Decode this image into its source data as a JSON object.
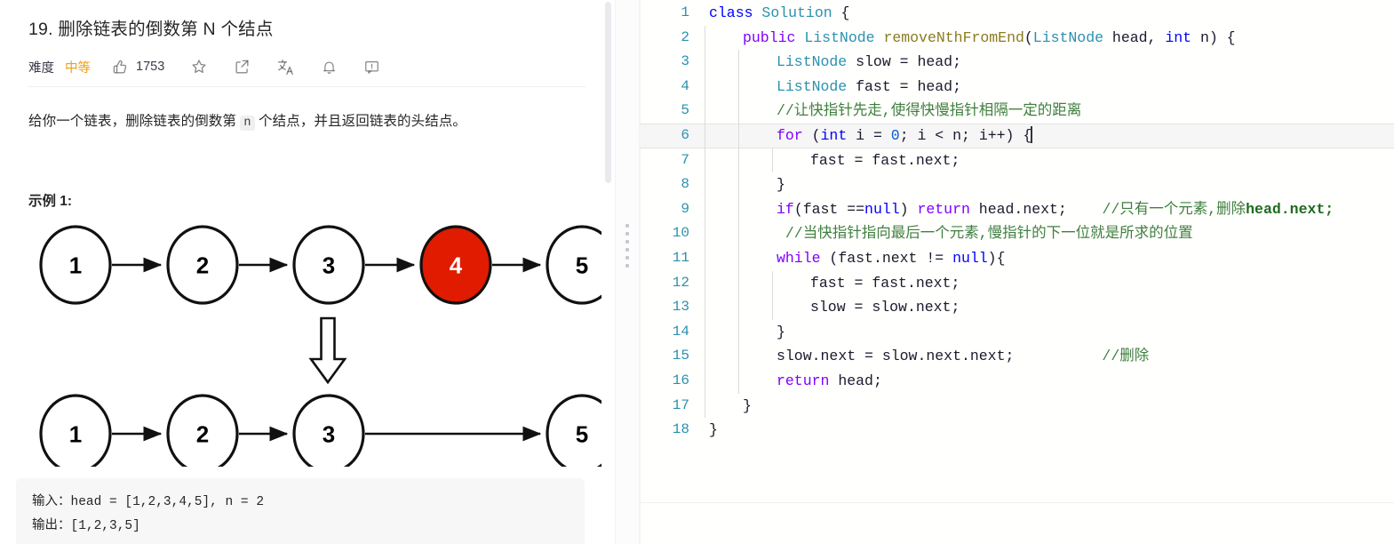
{
  "problem": {
    "title": "19. 删除链表的倒数第 N 个结点",
    "meta": {
      "difficulty_label": "难度",
      "difficulty_value": "中等",
      "difficulty_color": "#ef9f18",
      "like_count": "1753",
      "icons": [
        "thumbs-up-icon",
        "star-icon",
        "share-icon",
        "translate-icon",
        "bell-icon",
        "feedback-icon"
      ]
    },
    "description_pre": "给你一个链表，删除链表的倒数第 ",
    "description_code": "n",
    "description_post": " 个结点，并且返回链表的头结点。",
    "example_heading": "示例 1:",
    "example_io": "输入：head = [1,2,3,4,5], n = 2\n输出：[1,2,3,5]"
  },
  "diagram": {
    "row1": {
      "nodes": [
        "1",
        "2",
        "3",
        "4",
        "5"
      ],
      "highlighted_index": 3,
      "highlight_color": "#e01b00",
      "node_text_color": "#000000",
      "highlight_text_color": "#ffffff"
    },
    "row2": {
      "nodes": [
        "1",
        "2",
        "3",
        "5"
      ]
    },
    "down_arrow": "down-arrow-glyph"
  },
  "editor": {
    "language": "java",
    "active_line": 6,
    "lines": [
      {
        "n": "1",
        "indent": 0,
        "tokens": [
          {
            "t": "class",
            "c": "kw"
          },
          {
            "t": " ",
            "c": "plain"
          },
          {
            "t": "Solution",
            "c": "type"
          },
          {
            "t": " {",
            "c": "punct"
          }
        ]
      },
      {
        "n": "2",
        "indent": 1,
        "tokens": [
          {
            "t": "public",
            "c": "kw2"
          },
          {
            "t": " ",
            "c": "plain"
          },
          {
            "t": "ListNode",
            "c": "type"
          },
          {
            "t": " ",
            "c": "plain"
          },
          {
            "t": "removeNthFromEnd",
            "c": "fn"
          },
          {
            "t": "(",
            "c": "punct"
          },
          {
            "t": "ListNode",
            "c": "type"
          },
          {
            "t": " ",
            "c": "plain"
          },
          {
            "t": "head",
            "c": "plain"
          },
          {
            "t": ", ",
            "c": "punct"
          },
          {
            "t": "int",
            "c": "kw"
          },
          {
            "t": " ",
            "c": "plain"
          },
          {
            "t": "n",
            "c": "plain"
          },
          {
            "t": ") {",
            "c": "punct"
          }
        ]
      },
      {
        "n": "3",
        "indent": 2,
        "tokens": [
          {
            "t": "ListNode",
            "c": "type"
          },
          {
            "t": " ",
            "c": "plain"
          },
          {
            "t": "slow",
            "c": "plain"
          },
          {
            "t": " = ",
            "c": "punct"
          },
          {
            "t": "head",
            "c": "plain"
          },
          {
            "t": ";",
            "c": "punct"
          }
        ]
      },
      {
        "n": "4",
        "indent": 2,
        "tokens": [
          {
            "t": "ListNode",
            "c": "type"
          },
          {
            "t": " ",
            "c": "plain"
          },
          {
            "t": "fast",
            "c": "plain"
          },
          {
            "t": " = ",
            "c": "punct"
          },
          {
            "t": "head",
            "c": "plain"
          },
          {
            "t": ";",
            "c": "punct"
          }
        ]
      },
      {
        "n": "5",
        "indent": 2,
        "tokens": [
          {
            "t": "//让快指针先走,使得快慢指针相隔一定的距离",
            "c": "cmt"
          }
        ]
      },
      {
        "n": "6",
        "indent": 2,
        "active": true,
        "tokens": [
          {
            "t": "for",
            "c": "kw2"
          },
          {
            "t": " (",
            "c": "punct"
          },
          {
            "t": "int",
            "c": "kw"
          },
          {
            "t": " ",
            "c": "plain"
          },
          {
            "t": "i",
            "c": "plain"
          },
          {
            "t": " = ",
            "c": "punct"
          },
          {
            "t": "0",
            "c": "num"
          },
          {
            "t": "; ",
            "c": "punct"
          },
          {
            "t": "i",
            "c": "plain"
          },
          {
            "t": " < ",
            "c": "punct"
          },
          {
            "t": "n",
            "c": "plain"
          },
          {
            "t": "; ",
            "c": "punct"
          },
          {
            "t": "i",
            "c": "plain"
          },
          {
            "t": "++) {",
            "c": "punct"
          }
        ],
        "caret_after": true
      },
      {
        "n": "7",
        "indent": 3,
        "tokens": [
          {
            "t": "fast",
            "c": "plain"
          },
          {
            "t": " = ",
            "c": "punct"
          },
          {
            "t": "fast",
            "c": "plain"
          },
          {
            "t": ".",
            "c": "punct"
          },
          {
            "t": "next",
            "c": "plain"
          },
          {
            "t": ";",
            "c": "punct"
          }
        ]
      },
      {
        "n": "8",
        "indent": 2,
        "tokens": [
          {
            "t": "}",
            "c": "punct"
          }
        ]
      },
      {
        "n": "9",
        "indent": 2,
        "tokens": [
          {
            "t": "if",
            "c": "kw2"
          },
          {
            "t": "(",
            "c": "punct"
          },
          {
            "t": "fast",
            "c": "plain"
          },
          {
            "t": " ==",
            "c": "punct"
          },
          {
            "t": "null",
            "c": "kw"
          },
          {
            "t": ") ",
            "c": "punct"
          },
          {
            "t": "return",
            "c": "kw2"
          },
          {
            "t": " ",
            "c": "plain"
          },
          {
            "t": "head",
            "c": "plain"
          },
          {
            "t": ".",
            "c": "punct"
          },
          {
            "t": "next",
            "c": "plain"
          },
          {
            "t": ";",
            "c": "punct"
          },
          {
            "t": "    ",
            "c": "plain"
          },
          {
            "t": "//只有一个元素,删除",
            "c": "cmt"
          },
          {
            "t": "head.next;",
            "c": "cmt-b"
          }
        ]
      },
      {
        "n": "10",
        "indent": 2,
        "tokens": [
          {
            "t": " //当快指针指向最后一个元素,慢指针的下一位就是所求的位置",
            "c": "cmt"
          }
        ]
      },
      {
        "n": "11",
        "indent": 2,
        "tokens": [
          {
            "t": "while",
            "c": "kw2"
          },
          {
            "t": " (",
            "c": "punct"
          },
          {
            "t": "fast",
            "c": "plain"
          },
          {
            "t": ".",
            "c": "punct"
          },
          {
            "t": "next",
            "c": "plain"
          },
          {
            "t": " != ",
            "c": "punct"
          },
          {
            "t": "null",
            "c": "kw"
          },
          {
            "t": "){",
            "c": "punct"
          }
        ]
      },
      {
        "n": "12",
        "indent": 3,
        "tokens": [
          {
            "t": "fast",
            "c": "plain"
          },
          {
            "t": " = ",
            "c": "punct"
          },
          {
            "t": "fast",
            "c": "plain"
          },
          {
            "t": ".",
            "c": "punct"
          },
          {
            "t": "next",
            "c": "plain"
          },
          {
            "t": ";",
            "c": "punct"
          }
        ]
      },
      {
        "n": "13",
        "indent": 3,
        "tokens": [
          {
            "t": "slow",
            "c": "plain"
          },
          {
            "t": " = ",
            "c": "punct"
          },
          {
            "t": "slow",
            "c": "plain"
          },
          {
            "t": ".",
            "c": "punct"
          },
          {
            "t": "next",
            "c": "plain"
          },
          {
            "t": ";",
            "c": "punct"
          }
        ]
      },
      {
        "n": "14",
        "indent": 2,
        "tokens": [
          {
            "t": "}",
            "c": "punct"
          }
        ]
      },
      {
        "n": "15",
        "indent": 2,
        "tokens": [
          {
            "t": "slow",
            "c": "plain"
          },
          {
            "t": ".",
            "c": "punct"
          },
          {
            "t": "next",
            "c": "plain"
          },
          {
            "t": " = ",
            "c": "punct"
          },
          {
            "t": "slow",
            "c": "plain"
          },
          {
            "t": ".",
            "c": "punct"
          },
          {
            "t": "next",
            "c": "plain"
          },
          {
            "t": ".",
            "c": "punct"
          },
          {
            "t": "next",
            "c": "plain"
          },
          {
            "t": ";",
            "c": "punct"
          },
          {
            "t": "          ",
            "c": "plain"
          },
          {
            "t": "//删除",
            "c": "cmt"
          }
        ]
      },
      {
        "n": "16",
        "indent": 2,
        "tokens": [
          {
            "t": "return",
            "c": "kw2"
          },
          {
            "t": " ",
            "c": "plain"
          },
          {
            "t": "head",
            "c": "plain"
          },
          {
            "t": ";",
            "c": "punct"
          }
        ]
      },
      {
        "n": "17",
        "indent": 1,
        "tokens": [
          {
            "t": "}",
            "c": "punct"
          }
        ]
      },
      {
        "n": "18",
        "indent": 0,
        "tokens": [
          {
            "t": "}",
            "c": "punct"
          }
        ]
      }
    ]
  }
}
